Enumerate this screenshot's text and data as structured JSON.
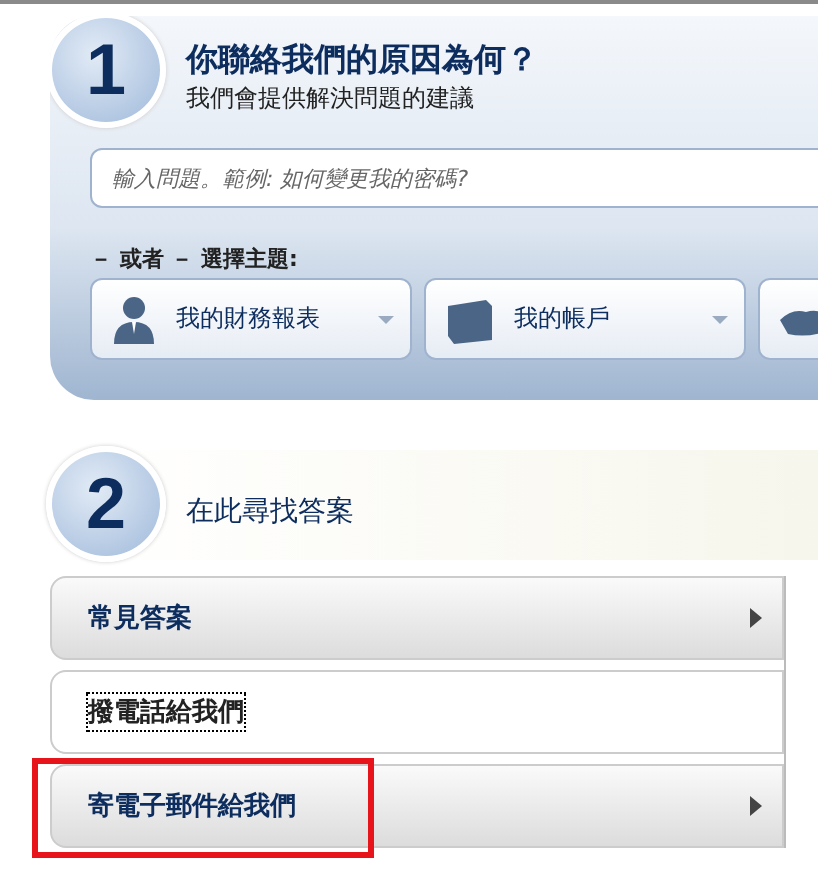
{
  "step1": {
    "number": "1",
    "title": "你聯絡我們的原因為何？",
    "subtitle": "我們會提供解決問題的建議",
    "search": {
      "placeholder": "輸入問題。範例: 如何變更我的密碼?"
    },
    "or_label": "－ 或者 － 選擇主題:",
    "topics": [
      {
        "kind": "labeled",
        "label": "我的財務報表"
      },
      {
        "kind": "labeled",
        "label": "我的帳戶"
      },
      {
        "kind": "cut"
      }
    ]
  },
  "step2": {
    "number": "2",
    "title": "在此尋找答案",
    "items": [
      {
        "label": "常見答案",
        "selected": false,
        "highlighted": false
      },
      {
        "label": "撥電話給我們",
        "selected": true,
        "highlighted": false
      },
      {
        "label": "寄電子郵件給我們",
        "selected": false,
        "highlighted": true
      }
    ]
  }
}
